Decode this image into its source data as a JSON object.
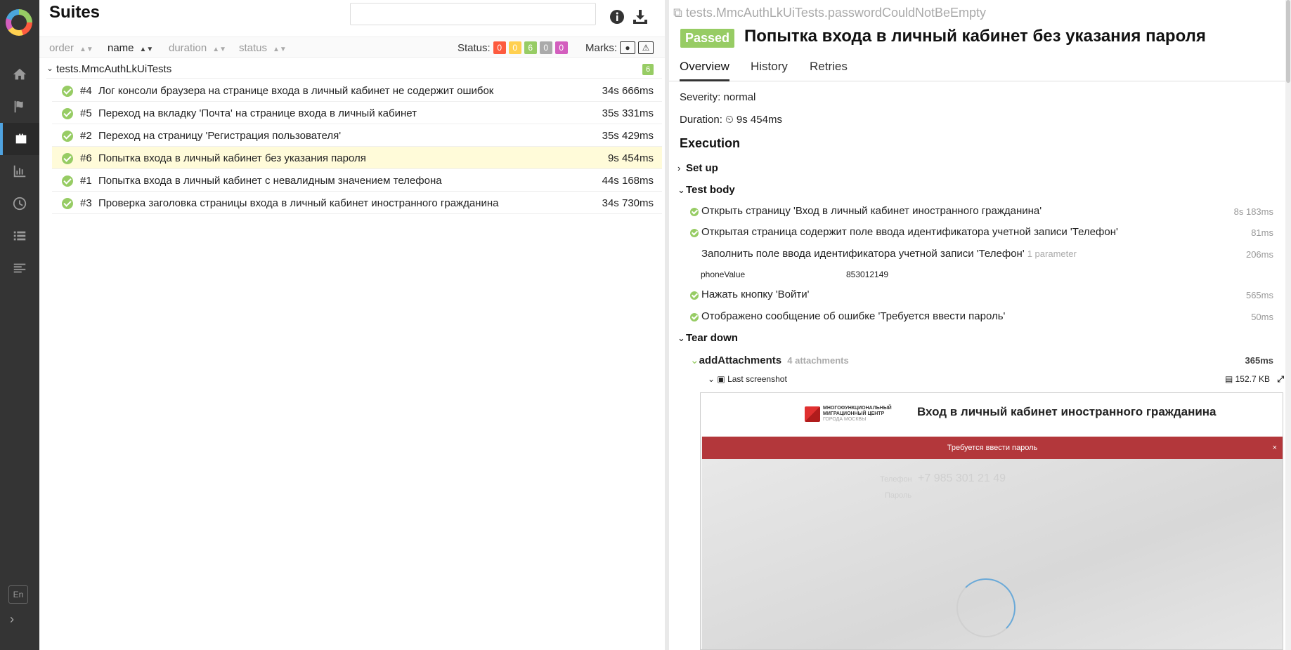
{
  "sidebar": {
    "lang": "En",
    "items": [
      {
        "icon": "home-icon"
      },
      {
        "icon": "flag-icon"
      },
      {
        "icon": "briefcase-icon"
      },
      {
        "icon": "bar-chart-icon"
      },
      {
        "icon": "clock-icon"
      },
      {
        "icon": "list-icon"
      },
      {
        "icon": "align-left-icon"
      }
    ]
  },
  "left": {
    "title": "Suites",
    "search": {
      "value": "",
      "placeholder": ""
    },
    "sort": {
      "order": "order",
      "name": "name",
      "duration": "duration",
      "status": "status"
    },
    "status_label": "Status:",
    "status_counts": [
      {
        "value": "0",
        "color": "#fd5a3e"
      },
      {
        "value": "0",
        "color": "#ffd050"
      },
      {
        "value": "6",
        "color": "#97cc64"
      },
      {
        "value": "0",
        "color": "#aaaaaa"
      },
      {
        "value": "0",
        "color": "#d35ebe"
      }
    ],
    "marks_label": "Marks:",
    "group": {
      "name": "tests.MmcAuthLkUiTests",
      "count": "6"
    },
    "tests": [
      {
        "num": "#4",
        "name": "Лог консоли браузера на странице входа в личный кабинет не содержит ошибок",
        "dur": "34s 666ms"
      },
      {
        "num": "#5",
        "name": "Переход на вкладку 'Почта' на странице входа в личный кабинет",
        "dur": "35s 331ms"
      },
      {
        "num": "#2",
        "name": "Переход на страницу 'Регистрация пользователя'",
        "dur": "35s 429ms"
      },
      {
        "num": "#6",
        "name": "Попытка входа в личный кабинет без указания пароля",
        "dur": "9s 454ms"
      },
      {
        "num": "#1",
        "name": "Попытка входа в личный кабинет с невалидным значением телефона",
        "dur": "44s 168ms"
      },
      {
        "num": "#3",
        "name": "Проверка заголовка страницы входа в личный кабинет иностранного гражданина",
        "dur": "34s 730ms"
      }
    ]
  },
  "right": {
    "path": "tests.MmcAuthLkUiTests.passwordCouldNotBeEmpty",
    "status": "Passed",
    "title": "Попытка входа в личный кабинет без указания пароля",
    "tabs": [
      "Overview",
      "History",
      "Retries"
    ],
    "severity": "Severity: normal",
    "duration_label": "Duration:",
    "duration": "9s 454ms",
    "execution": "Execution",
    "setup": "Set up",
    "body": "Test body",
    "steps": [
      {
        "text": "Открыть страницу 'Вход в личный кабинет иностранного гражданина'",
        "dur": "8s 183ms"
      },
      {
        "text": "Открытая страница содержит поле ввода идентификатора учетной записи 'Телефон'",
        "dur": "81ms"
      },
      {
        "text": "Заполнить поле ввода идентификатора учетной записи 'Телефон'",
        "param": "1 parameter",
        "dur": "206ms"
      },
      {
        "text": "Нажать кнопку 'Войти'",
        "dur": "565ms"
      },
      {
        "text": "Отображено сообщение об ошибке 'Требуется ввести пароль'",
        "dur": "50ms"
      }
    ],
    "param": {
      "name": "phoneValue",
      "value": "853012149"
    },
    "teardown": "Tear down",
    "attach": {
      "name": "addAttachments",
      "count": "4 attachments",
      "dur": "365ms"
    },
    "screenshot": {
      "label": "Last screenshot",
      "size": "152.7 KB"
    },
    "embedded": {
      "org_line1": "МНОГОФУНКЦИОНАЛЬНЫЙ",
      "org_line2": "МИГРАЦИОННЫЙ ЦЕНТР",
      "org_line3": "ГОРОДА МОСКВЫ",
      "title": "Вход в личный кабинет иностранного гражданина",
      "error": "Требуется ввести пароль",
      "close": "×",
      "phone_label": "Телефон",
      "phone_value": "+7 985 301 21 49",
      "password_label": "Пароль"
    }
  }
}
